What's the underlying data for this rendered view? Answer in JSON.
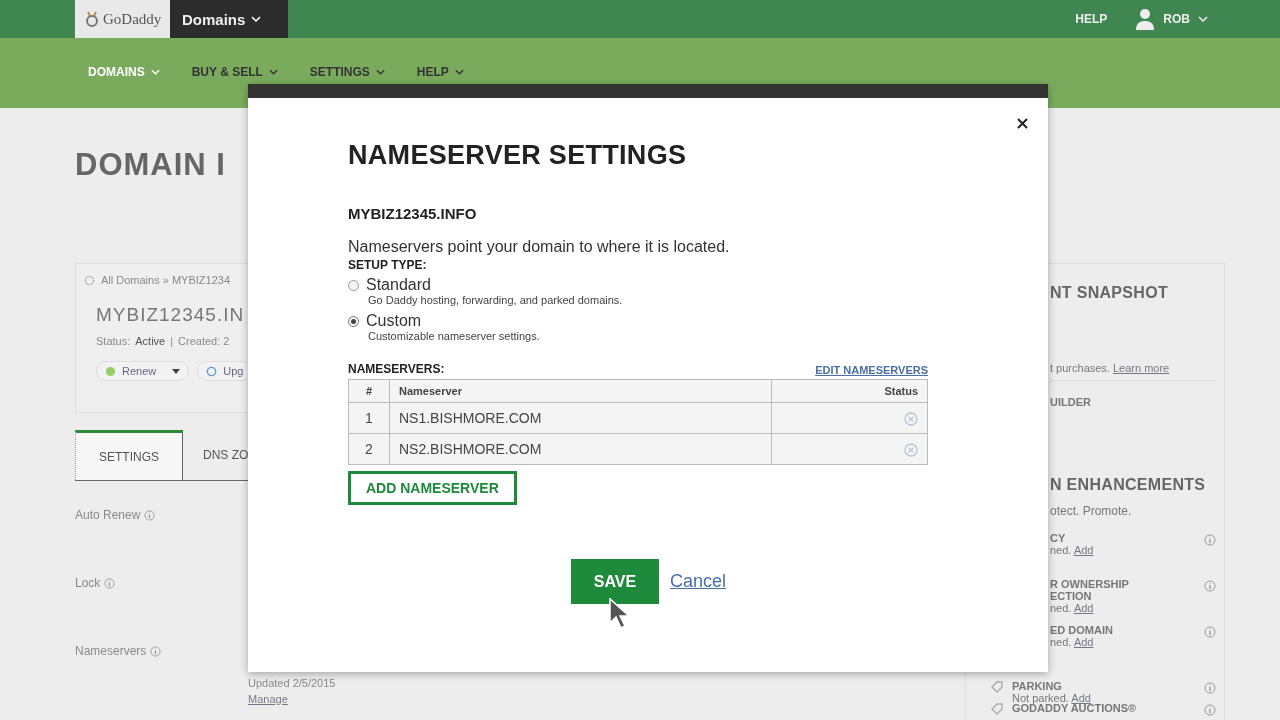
{
  "header": {
    "logo": "GoDaddy",
    "product_menu": "Domains",
    "help": "HELP",
    "user": "ROB"
  },
  "nav": [
    {
      "label": "DOMAINS",
      "selected": true
    },
    {
      "label": "BUY & SELL",
      "selected": false
    },
    {
      "label": "SETTINGS",
      "selected": false
    },
    {
      "label": "HELP",
      "selected": false
    }
  ],
  "page_title": "DOMAIN I",
  "domain_card": {
    "breadcrumb": "All Domains » MYBIZ1234",
    "domain": "MYBIZ12345.IN",
    "status_label": "Status:",
    "status": "Active",
    "separator": "|",
    "created": "Created: 2",
    "buttons": [
      "Renew",
      "Upg"
    ]
  },
  "tabs": [
    {
      "label": "SETTINGS",
      "selected": true
    },
    {
      "label": "DNS ZO",
      "selected": false
    }
  ],
  "settings_rows": [
    "Auto Renew",
    "Lock",
    "Nameservers"
  ],
  "nameserver_info": {
    "updated": "Updated 2/5/2015",
    "link": "Manage"
  },
  "sidebar": {
    "snapshot_title": "NT SNAPSHOT",
    "snapshot_text": "t purchases.",
    "snapshot_link": "Learn more",
    "builder": "UILDER",
    "enhancements_title": "N ENHANCEMENTS",
    "enhancements_text": "otect. Promote.",
    "items": [
      {
        "lines": [
          "CY"
        ],
        "status": "ned.",
        "link": "Add"
      },
      {
        "lines": [
          "R OWNERSHIP",
          "ECTION"
        ],
        "status": "ned.",
        "link": "Add"
      },
      {
        "lines": [
          "ED DOMAIN"
        ],
        "status": "ned.",
        "link": "Add"
      }
    ],
    "lower_items": [
      {
        "name": "PARKING",
        "status": "Not parked.",
        "link": "Add"
      },
      {
        "name": "GODADDY AUCTIONS®"
      }
    ]
  },
  "modal": {
    "title": "NAMESERVER SETTINGS",
    "domain": "MYBIZ12345.INFO",
    "description": "Nameservers point your domain to where it is located.",
    "setup_label": "SETUP TYPE:",
    "setup_options": [
      {
        "label": "Standard",
        "hint": "Go Daddy hosting, forwarding, and parked domains.",
        "selected": false
      },
      {
        "label": "Custom",
        "hint": "Customizable nameserver settings.",
        "selected": true
      }
    ],
    "nameservers_label": "NAMESERVERS:",
    "edit_link": "EDIT NAMESERVERS",
    "columns": [
      "#",
      "Nameserver",
      "Status"
    ],
    "rows": [
      {
        "number": "1",
        "nameserver": "NS1.BISHMORE.COM"
      },
      {
        "number": "2",
        "nameserver": "NS2.BISHMORE.COM"
      }
    ],
    "add_button": "ADD NAMESERVER",
    "save_button": "SAVE",
    "cancel_link": "Cancel"
  }
}
